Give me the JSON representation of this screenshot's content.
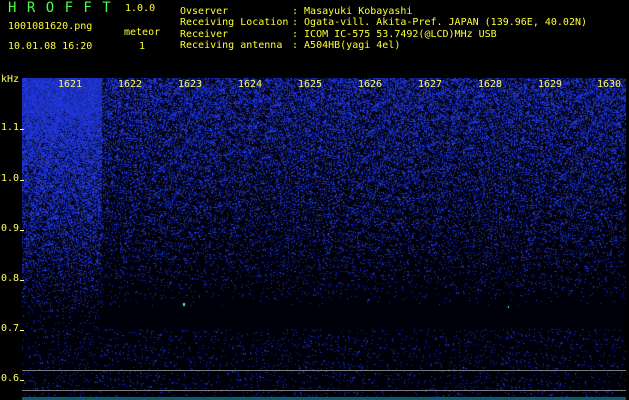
{
  "app": {
    "name": "H R O F F T",
    "version": "1.0.0"
  },
  "file": {
    "name": "1001081620.png",
    "timestamp": "10.01.08 16:20"
  },
  "meteor": {
    "label": "meteor",
    "count": "1"
  },
  "info": [
    {
      "key": "Ovserver",
      "value": ": Masayuki Kobayashi"
    },
    {
      "key": "Receiving Location",
      "value": ": Ogata-vill. Akita-Pref. JAPAN (139.96E, 40.02N)"
    },
    {
      "key": "Receiver",
      "value": ": ICOM IC-575 53.7492(@LCD)MHz USB"
    },
    {
      "key": "Receiving antenna",
      "value": ": A504HB(yagi 4el)"
    }
  ],
  "axis": {
    "y_unit": "kHz",
    "y_ticks": [
      "1.1",
      "1.0",
      "0.9",
      "0.8",
      "0.7",
      "0.6"
    ],
    "x_ticks": [
      "1621",
      "1622",
      "1623",
      "1624",
      "1625",
      "1626",
      "1627",
      "1628",
      "1629",
      "1630"
    ]
  },
  "colors": {
    "accent_yellow": "#ffff33",
    "title_green": "#44ff44",
    "noise_blue": "#2a3cff"
  }
}
